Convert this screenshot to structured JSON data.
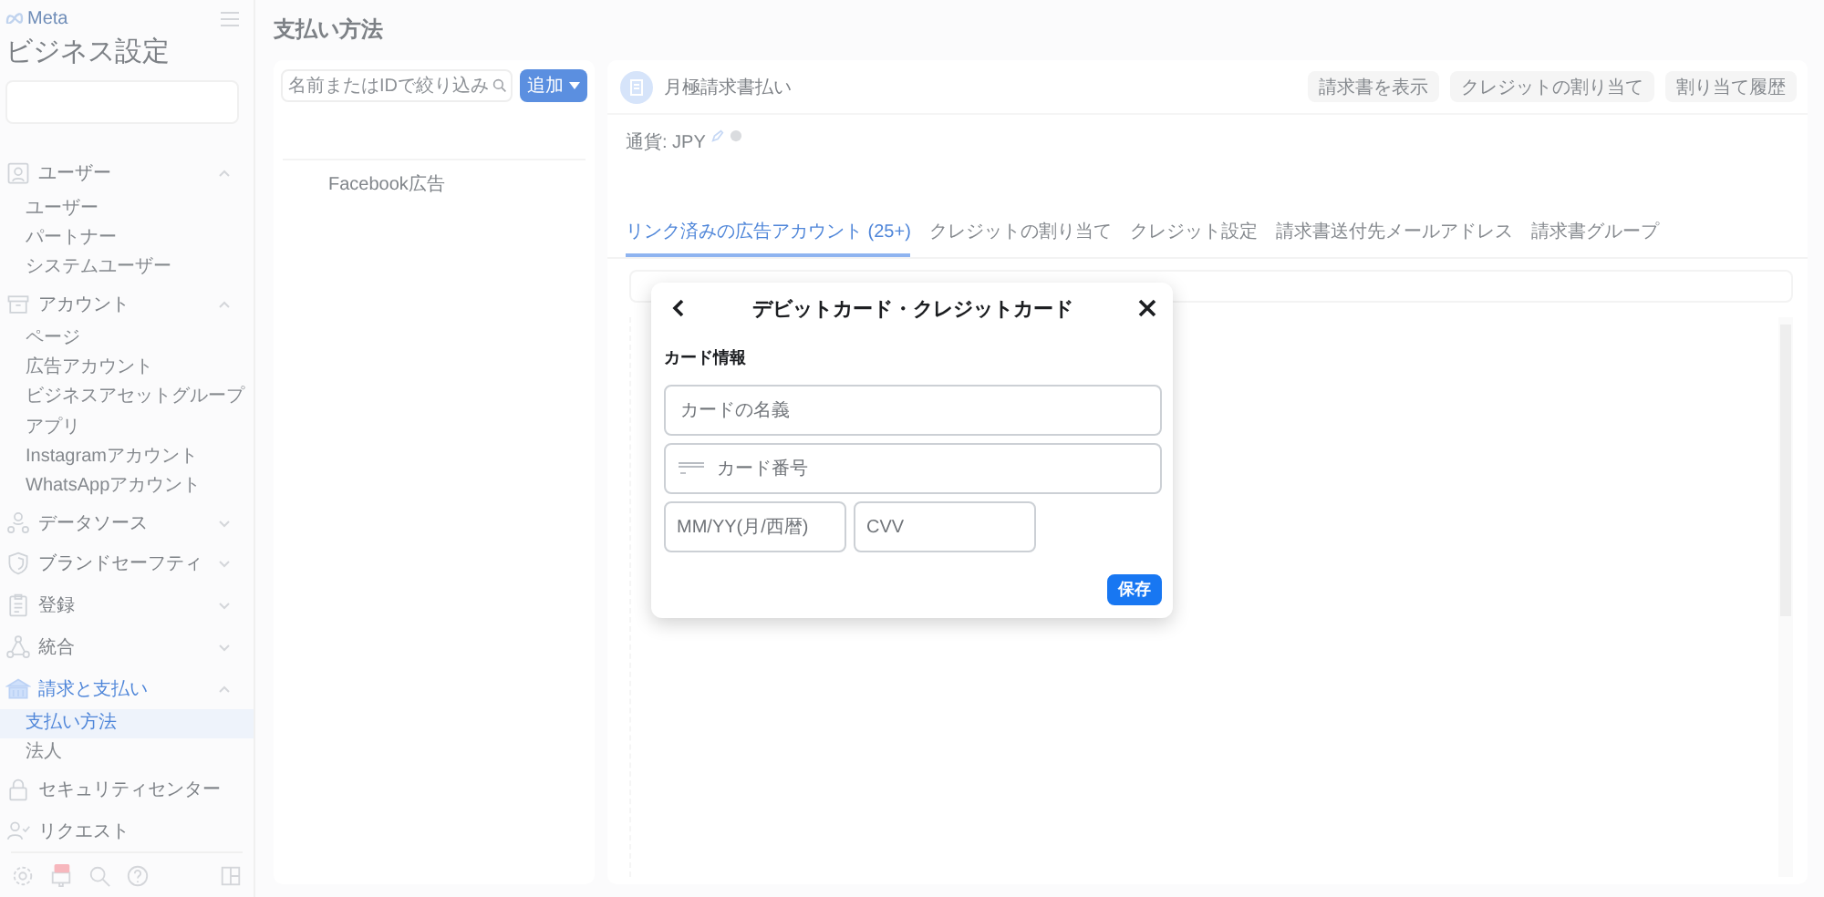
{
  "sidebar": {
    "logo": "Meta",
    "title": "ビジネス設定",
    "groups": [
      {
        "kind": "section",
        "label": "ユーザー",
        "active": false,
        "expanded": true,
        "children": [
          {
            "label": "ユーザー",
            "selected": false
          },
          {
            "label": "パートナー",
            "selected": false
          },
          {
            "label": "システムユーザー",
            "selected": false
          }
        ]
      },
      {
        "kind": "section",
        "label": "アカウント",
        "active": false,
        "expanded": true,
        "children": [
          {
            "label": "ページ",
            "selected": false
          },
          {
            "label": "広告アカウント",
            "selected": false
          },
          {
            "label": "ビジネスアセットグループ",
            "selected": false
          },
          {
            "label": "アプリ",
            "selected": false
          },
          {
            "label": "Instagramアカウント",
            "selected": false
          },
          {
            "label": "WhatsAppアカウント",
            "selected": false
          }
        ]
      },
      {
        "kind": "section",
        "label": "データソース",
        "active": false,
        "expanded": false
      },
      {
        "kind": "section",
        "label": "ブランドセーフティ",
        "active": false,
        "expanded": false
      },
      {
        "kind": "section",
        "label": "登録",
        "active": false,
        "expanded": false
      },
      {
        "kind": "section",
        "label": "統合",
        "active": false,
        "expanded": false
      },
      {
        "kind": "section",
        "label": "請求と支払い",
        "active": true,
        "expanded": true,
        "children": [
          {
            "label": "支払い方法",
            "selected": true
          },
          {
            "label": "法人",
            "selected": false
          }
        ]
      },
      {
        "kind": "link",
        "label": "セキュリティセンター",
        "active": false
      },
      {
        "kind": "link",
        "label": "リクエスト",
        "active": false
      }
    ]
  },
  "page_title": "支払い方法",
  "list_panel": {
    "search": {
      "placeholder": "名前またはIDで絞り込み"
    },
    "add_button": "追加",
    "items": [
      "Facebook広告"
    ]
  },
  "detail": {
    "title": "月極請求書払い",
    "buttons": [
      "請求書を表示",
      "クレジットの割り当て",
      "割り当て履歴"
    ],
    "currency": "通貨: JPY",
    "tabs": [
      {
        "label": "リンク済みの広告アカウント (25+)",
        "selected": true
      },
      {
        "label": "クレジットの割り当て",
        "selected": false
      },
      {
        "label": "クレジット設定",
        "selected": false
      },
      {
        "label": "請求書送付先メールアドレス",
        "selected": false
      },
      {
        "label": "請求書グループ",
        "selected": false
      }
    ]
  },
  "dialog": {
    "title": "デビットカード・クレジットカード",
    "section": "カード情報",
    "name_field": {
      "placeholder": "カードの名義"
    },
    "number_field": {
      "placeholder": "カード番号"
    },
    "expiry_field": {
      "placeholder": "MM/YY(月/西暦)"
    },
    "cvv_field": {
      "placeholder": "CVV"
    },
    "save_button": "保存"
  }
}
